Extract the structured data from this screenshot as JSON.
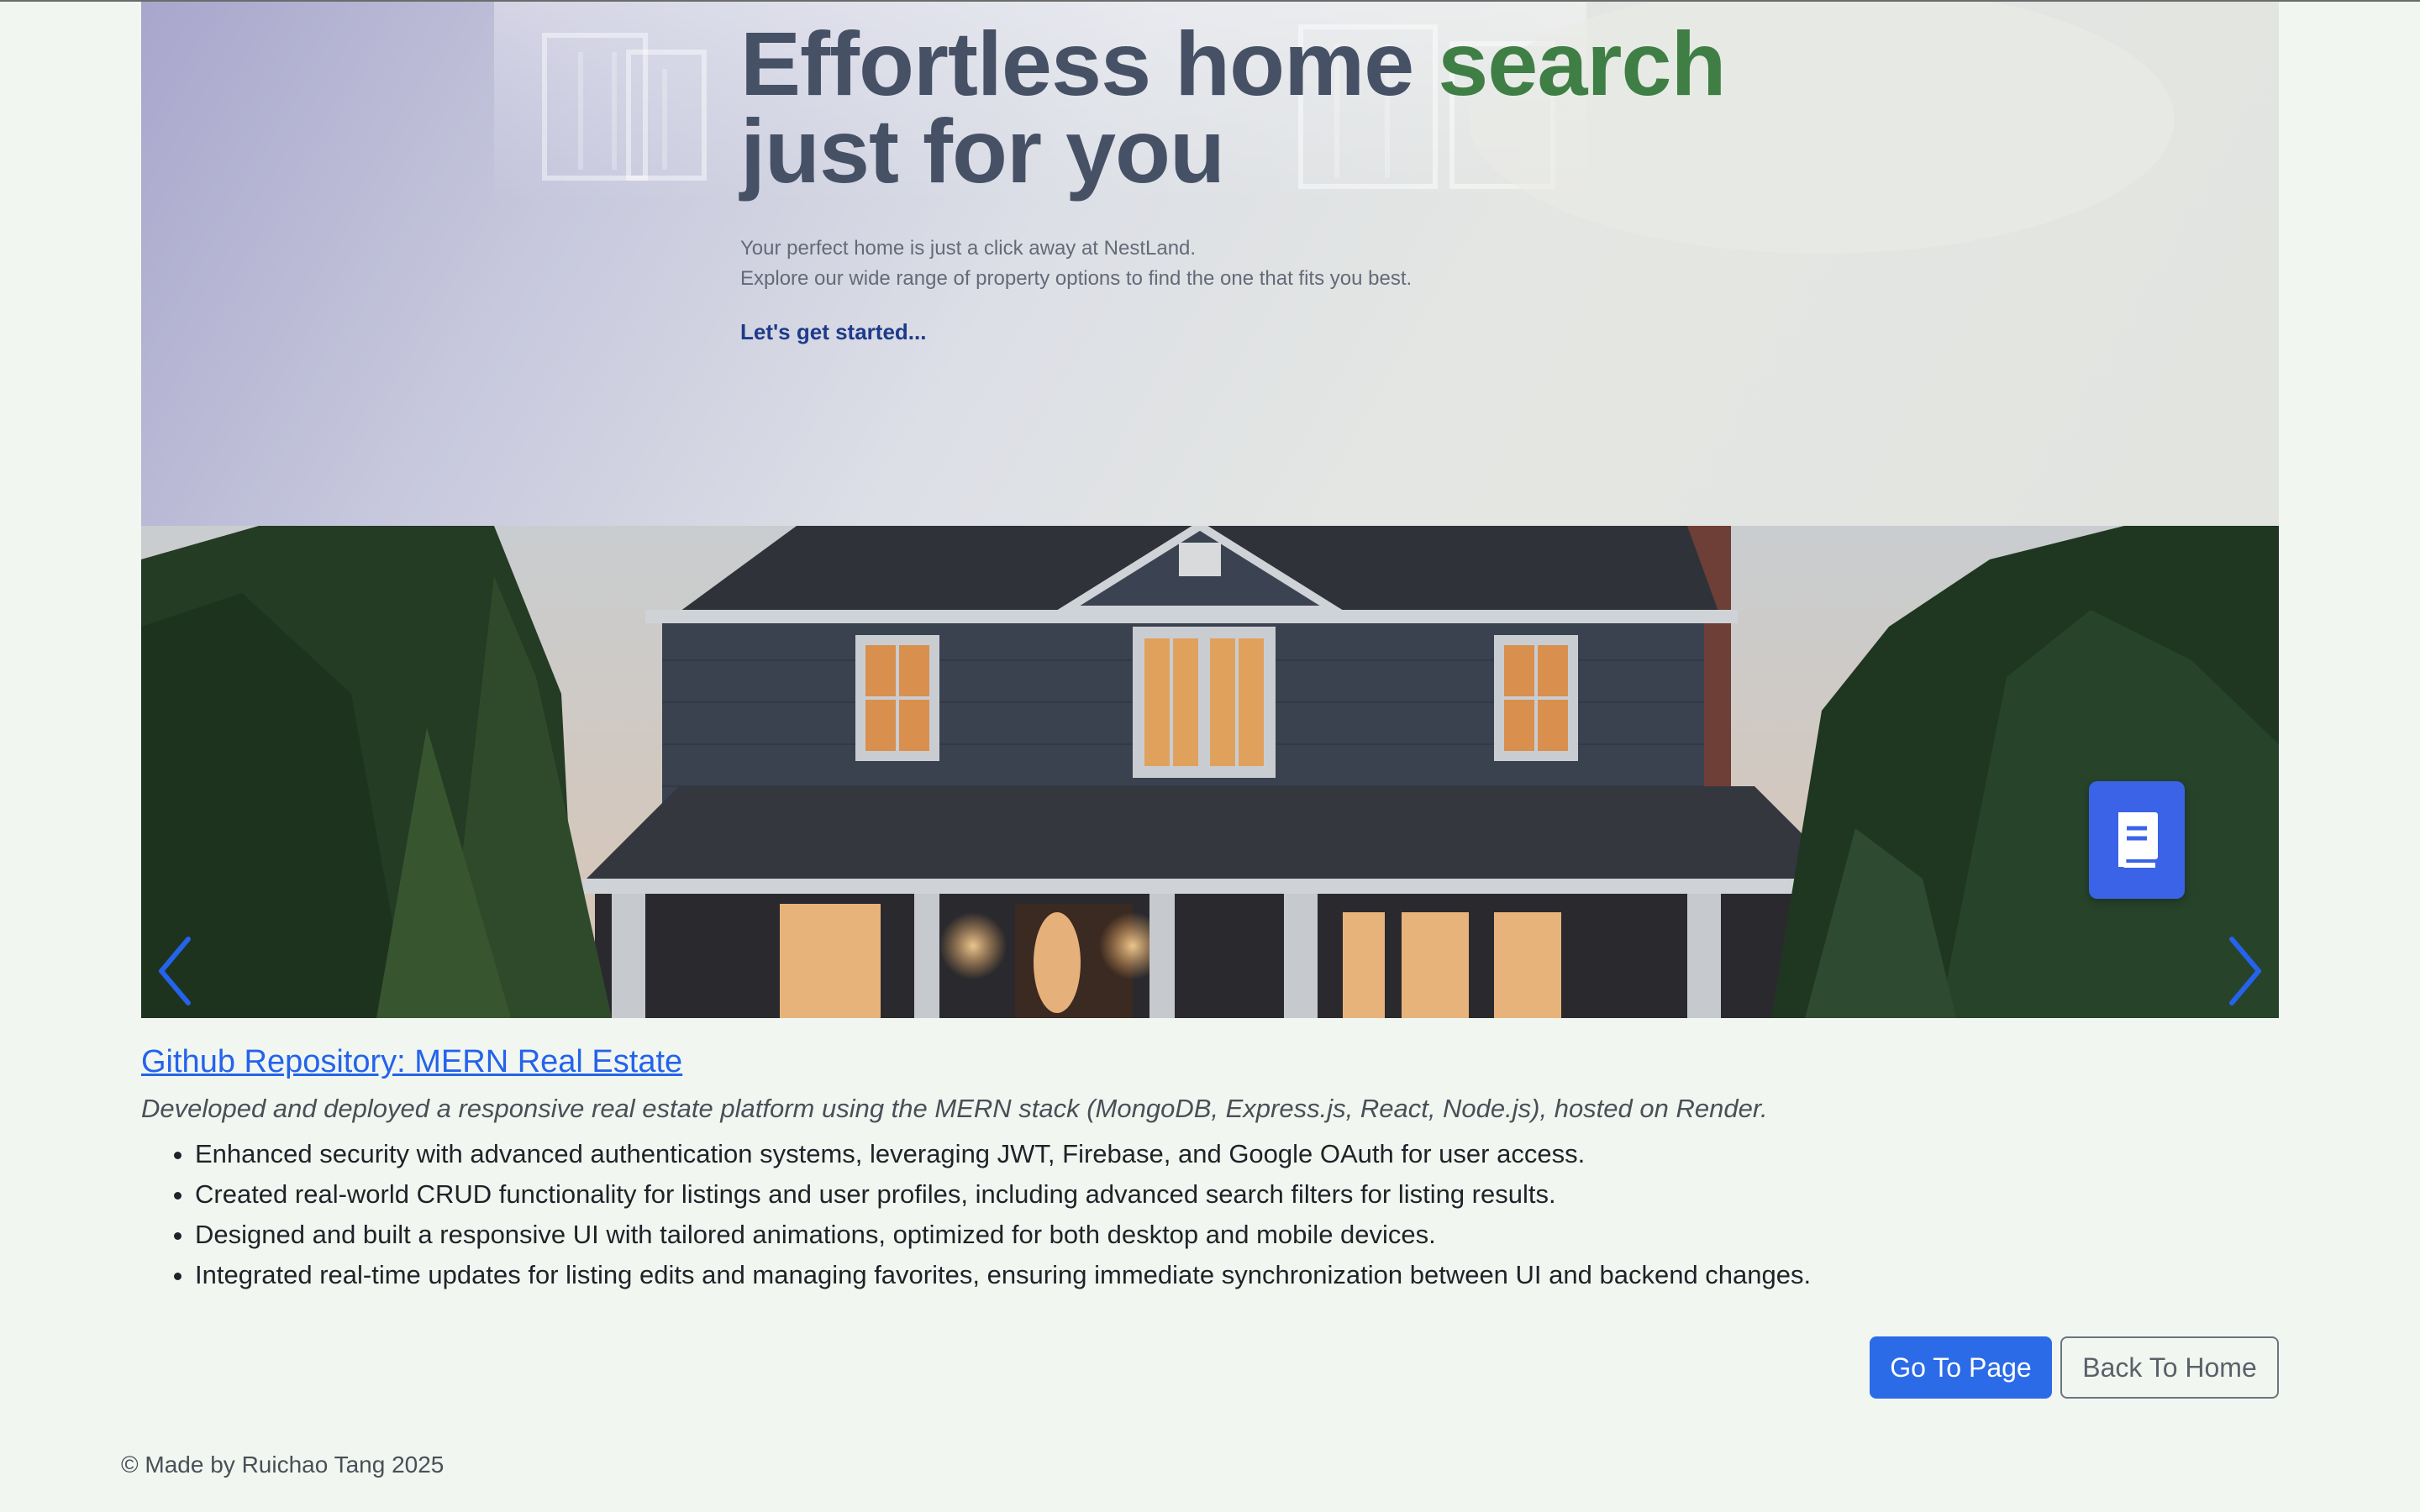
{
  "hero": {
    "title_line1_part1": "Effortless home ",
    "title_line1_accent": "search",
    "title_line2": "just for you",
    "subtitle_line1": "Your perfect home is just a click away at NestLand.",
    "subtitle_line2": "Explore our wide range of property options to find the one that fits you best.",
    "cta": "Let's get started..."
  },
  "carousel": {
    "prev_icon": "chevron-left-icon",
    "next_icon": "chevron-right-icon",
    "badge_icon": "book-icon"
  },
  "project": {
    "repo_link": "Github Repository: MERN Real Estate",
    "description": "Developed and deployed a responsive real estate platform using the MERN stack (MongoDB, Express.js, React, Node.js), hosted on Render.",
    "bullets": [
      "Enhanced security with advanced authentication systems, leveraging JWT, Firebase, and Google OAuth for user access.",
      "Created real-world CRUD functionality for listings and user profiles, including advanced search filters for listing results.",
      "Designed and built a responsive UI with tailored animations, optimized for both desktop and mobile devices.",
      "Integrated real-time updates for listing edits and managing favorites, ensuring immediate synchronization between UI and backend changes."
    ]
  },
  "actions": {
    "go_to_page": "Go To Page",
    "back_to_home": "Back To Home"
  },
  "footer": {
    "text": "© Made by Ruichao Tang 2025"
  },
  "colors": {
    "accent_green": "#3f7f45",
    "primary_blue": "#2b6be8",
    "page_bg": "#f1f6f1"
  }
}
